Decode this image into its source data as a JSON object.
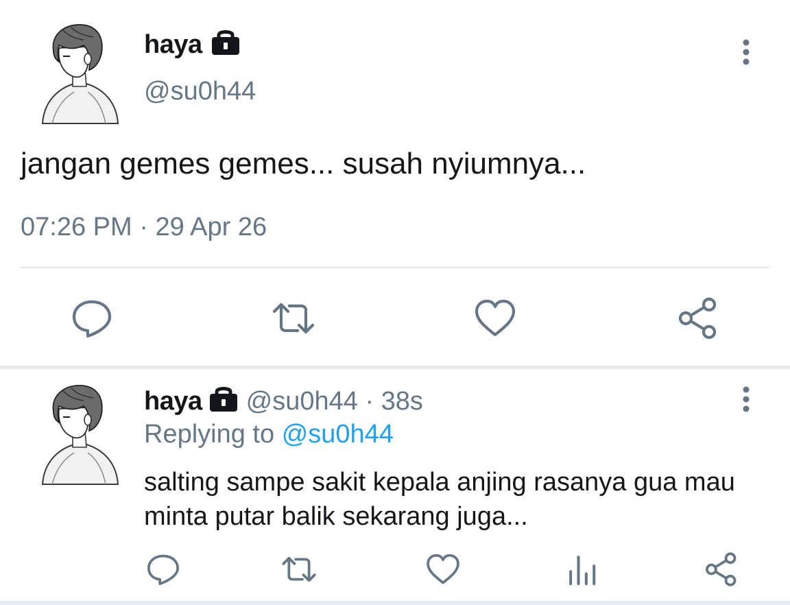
{
  "tweet": {
    "author_name": "haya",
    "author_handle": "@su0h44",
    "text": "jangan gemes gemes... susah nyiumnya...",
    "time": "07:26 PM",
    "separator": "·",
    "date": "29 Apr 26",
    "icons": {
      "lock": "lock-icon",
      "more": "more-vertical-icon",
      "reply": "reply-icon",
      "retweet": "retweet-icon",
      "like": "heart-icon",
      "share": "share-icon"
    }
  },
  "reply": {
    "author_name": "haya",
    "author_handle": "@su0h44",
    "separator": "·",
    "time_ago": "38s",
    "replying_prefix": "Replying to",
    "replying_to": "@su0h44",
    "text": "salting sampe sakit kepala anjing rasanya gua mau minta putar balik sekarang juga...",
    "icons": {
      "lock": "lock-icon",
      "more": "more-vertical-icon",
      "reply": "reply-icon",
      "retweet": "retweet-icon",
      "like": "heart-icon",
      "stats": "analytics-icon",
      "share": "share-icon"
    }
  },
  "colors": {
    "text_primary": "#14171a",
    "text_secondary": "#657786",
    "link": "#1da1f2",
    "divider": "#e1e8ed"
  }
}
